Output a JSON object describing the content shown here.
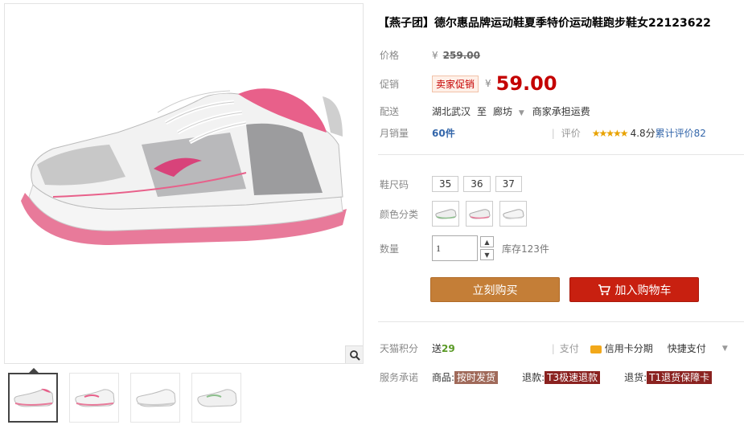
{
  "product": {
    "title": "【燕子团】德尔惠品牌运动鞋夏季特价运动鞋跑步鞋女22123622"
  },
  "price": {
    "original_label": "价格",
    "original_currency": "¥",
    "original_value": "259.00",
    "promo_label": "促销",
    "promo_tag": "卖家促销",
    "promo_currency": "¥",
    "promo_value": "59.00"
  },
  "shipping": {
    "label": "配送",
    "from": "湖北武汉",
    "to_word": "至",
    "to": "廊坊",
    "fee": "商家承担运费"
  },
  "sales": {
    "label": "月销量",
    "count": "60件",
    "rating_label": "评价",
    "stars": "★★★★★",
    "score": "4.8分",
    "review_text": "累计评价82"
  },
  "options": {
    "size_label": "鞋尺码",
    "sizes": [
      "35",
      "36",
      "37"
    ],
    "color_label": "颜色分类",
    "quantity_label": "数量",
    "quantity_value": "1",
    "stock": "库存123件"
  },
  "actions": {
    "buy_now": "立刻购买",
    "add_cart": "加入购物车"
  },
  "extras": {
    "points_label": "天猫积分",
    "points_prefix": "送",
    "points_value": "29",
    "pay_label": "支付",
    "installment": "信用卡分期",
    "quick_pay": "快捷支付",
    "service_label": "服务承诺",
    "services": [
      {
        "prefix": "商品:",
        "tag": "按时发货"
      },
      {
        "prefix": "退款:",
        "tag": "T3极速退款"
      },
      {
        "prefix": "退货:",
        "tag": "T1退货保障卡"
      }
    ]
  },
  "colors": {
    "accent_red": "#c40000",
    "buy_button": "#c47e37",
    "cart_button": "#c82010"
  }
}
